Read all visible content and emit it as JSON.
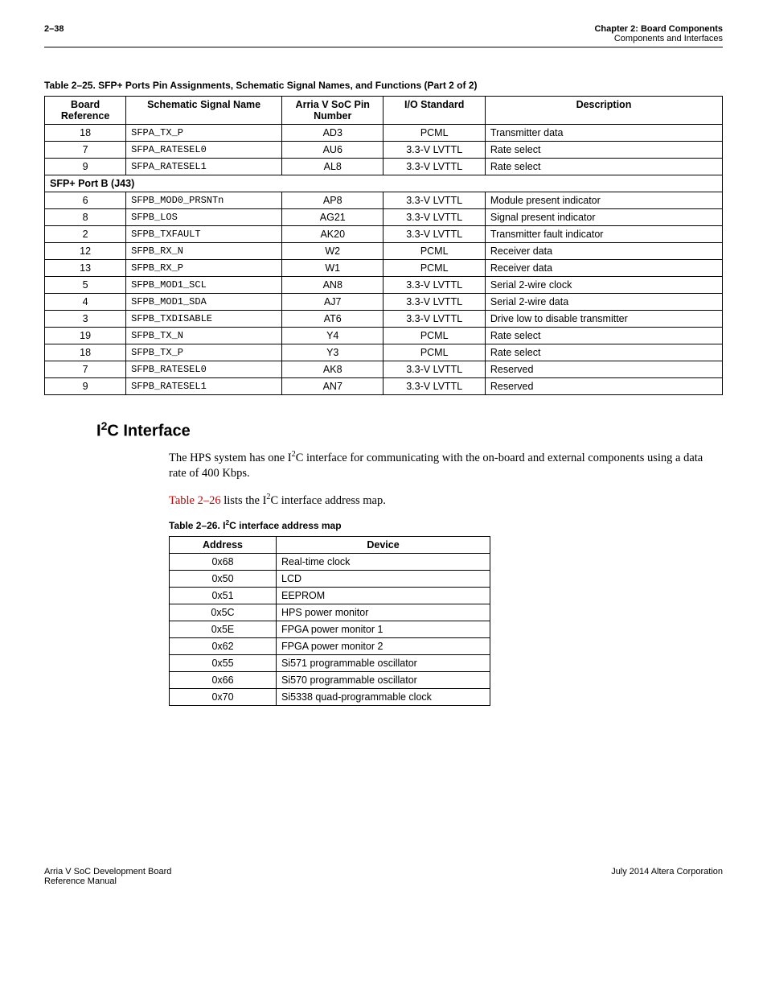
{
  "header": {
    "pageNum": "2–38",
    "chapter": "Chapter 2: Board Components",
    "section": "Components and Interfaces"
  },
  "table25": {
    "caption": "Table 2–25. SFP+ Ports Pin Assignments, Schematic Signal Names, and Functions (Part 2 of 2)",
    "headers": [
      "Board Reference",
      "Schematic Signal Name",
      "Arria V SoC Pin Number",
      "I/O Standard",
      "Description"
    ],
    "rows": [
      {
        "ref": "18",
        "sig": "SFPA_TX_P",
        "pin": "AD3",
        "io": "PCML",
        "desc": "Transmitter data"
      },
      {
        "ref": "7",
        "sig": "SFPA_RATESEL0",
        "pin": "AU6",
        "io": "3.3-V LVTTL",
        "desc": "Rate select"
      },
      {
        "ref": "9",
        "sig": "SFPA_RATESEL1",
        "pin": "AL8",
        "io": "3.3-V LVTTL",
        "desc": "Rate select"
      }
    ],
    "subhead": "SFP+ Port B (J43)",
    "rows2": [
      {
        "ref": "6",
        "sig": "SFPB_MOD0_PRSNTn",
        "pin": "AP8",
        "io": "3.3-V LVTTL",
        "desc": "Module present indicator"
      },
      {
        "ref": "8",
        "sig": "SFPB_LOS",
        "pin": "AG21",
        "io": "3.3-V LVTTL",
        "desc": "Signal present indicator"
      },
      {
        "ref": "2",
        "sig": "SFPB_TXFAULT",
        "pin": "AK20",
        "io": "3.3-V LVTTL",
        "desc": "Transmitter fault indicator"
      },
      {
        "ref": "12",
        "sig": "SFPB_RX_N",
        "pin": "W2",
        "io": "PCML",
        "desc": "Receiver data"
      },
      {
        "ref": "13",
        "sig": "SFPB_RX_P",
        "pin": "W1",
        "io": "PCML",
        "desc": "Receiver data"
      },
      {
        "ref": "5",
        "sig": "SFPB_MOD1_SCL",
        "pin": "AN8",
        "io": "3.3-V LVTTL",
        "desc": "Serial 2-wire clock"
      },
      {
        "ref": "4",
        "sig": "SFPB_MOD1_SDA",
        "pin": "AJ7",
        "io": "3.3-V LVTTL",
        "desc": "Serial 2-wire data"
      },
      {
        "ref": "3",
        "sig": "SFPB_TXDISABLE",
        "pin": "AT6",
        "io": "3.3-V LVTTL",
        "desc": "Drive low to disable transmitter"
      },
      {
        "ref": "19",
        "sig": "SFPB_TX_N",
        "pin": "Y4",
        "io": "PCML",
        "desc": "Rate select"
      },
      {
        "ref": "18",
        "sig": "SFPB_TX_P",
        "pin": "Y3",
        "io": "PCML",
        "desc": "Rate select"
      },
      {
        "ref": "7",
        "sig": "SFPB_RATESEL0",
        "pin": "AK8",
        "io": "3.3-V LVTTL",
        "desc": "Reserved"
      },
      {
        "ref": "9",
        "sig": "SFPB_RATESEL1",
        "pin": "AN7",
        "io": "3.3-V LVTTL",
        "desc": "Reserved"
      }
    ]
  },
  "i2c": {
    "title_pre": "I",
    "title_sup": "2",
    "title_post": "C Interface",
    "para1_pre": "The HPS system has one I",
    "para1_post": "C interface for communicating with the on-board and external components using a data rate of 400 Kbps.",
    "para2_link": "Table 2–26",
    "para2_mid": " lists the I",
    "para2_post": "C interface address map."
  },
  "table26": {
    "caption_pre": "Table 2–26. I",
    "caption_post": "C interface address map",
    "headers": [
      "Address",
      "Device"
    ],
    "rows": [
      {
        "addr": "0x68",
        "dev": "Real-time clock"
      },
      {
        "addr": "0x50",
        "dev": "LCD"
      },
      {
        "addr": "0x51",
        "dev": "EEPROM"
      },
      {
        "addr": "0x5C",
        "dev": "HPS power monitor"
      },
      {
        "addr": "0x5E",
        "dev": "FPGA power monitor 1"
      },
      {
        "addr": "0x62",
        "dev": "FPGA power monitor 2"
      },
      {
        "addr": "0x55",
        "dev": "Si571 programmable oscillator"
      },
      {
        "addr": "0x66",
        "dev": "Si570 programmable oscillator"
      },
      {
        "addr": "0x70",
        "dev": "Si5338 quad-programmable clock"
      }
    ]
  },
  "footer": {
    "left1": "Arria V SoC Development Board",
    "left2": "Reference Manual",
    "right": "July 2014   Altera Corporation"
  }
}
